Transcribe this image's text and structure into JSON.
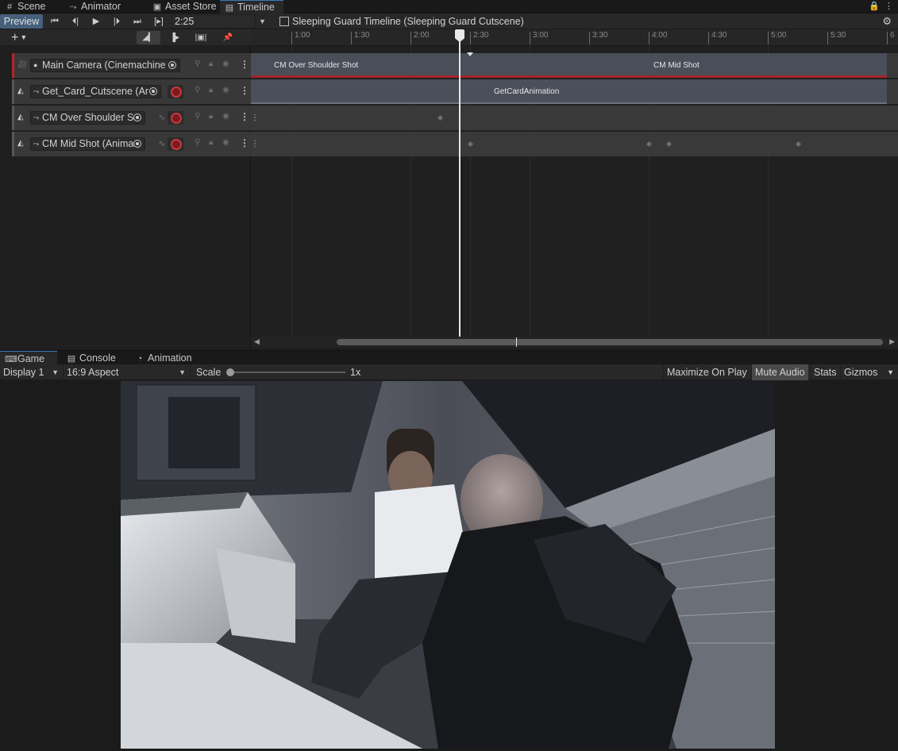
{
  "top_tabs": [
    {
      "label": "Scene",
      "icon": "grid-icon"
    },
    {
      "label": "Animator",
      "icon": "animator-icon"
    },
    {
      "label": "Asset Store",
      "icon": "bag-icon"
    },
    {
      "label": "Timeline",
      "icon": "timeline-icon"
    }
  ],
  "timeline": {
    "preview_label": "Preview",
    "frame_mode_label": "[▸]",
    "current_time": "2:25",
    "title": "Sleeping Guard Timeline (Sleeping Guard Cutscene)",
    "ruler_ticks": [
      "1:00",
      "1:30",
      "2:00",
      "2:30",
      "3:00",
      "3:30",
      "4:00",
      "4:30",
      "5:00",
      "5:30",
      "6"
    ],
    "tracks": [
      {
        "name": "Main Camera (Cinemachine",
        "type": "cinemachine",
        "clips": [
          "CM Over Shoulder Shot",
          "CM Mid Shot"
        ]
      },
      {
        "name": "Get_Card_Cutscene (Ar",
        "type": "animation",
        "clips": [
          "GetCardAnimation"
        ]
      },
      {
        "name": "CM Over Shoulder S",
        "type": "animation",
        "clips": []
      },
      {
        "name": "CM Mid Shot (Anima",
        "type": "animation",
        "clips": []
      }
    ]
  },
  "game_tabs": [
    {
      "label": "Game",
      "icon": "gamepad-icon"
    },
    {
      "label": "Console",
      "icon": "console-icon"
    },
    {
      "label": "Animation",
      "icon": "clock-icon"
    }
  ],
  "game_toolbar": {
    "display": "Display 1",
    "aspect": "16:9 Aspect",
    "scale_label": "Scale",
    "scale_value": "1x",
    "maximize": "Maximize On Play",
    "mute": "Mute Audio",
    "stats": "Stats",
    "gizmos": "Gizmos"
  },
  "colors": {
    "preview_active": "#46607c",
    "camera_track_accent": "#b8232a",
    "record_red": "#c9383e",
    "playhead": "#e8e8e8"
  }
}
